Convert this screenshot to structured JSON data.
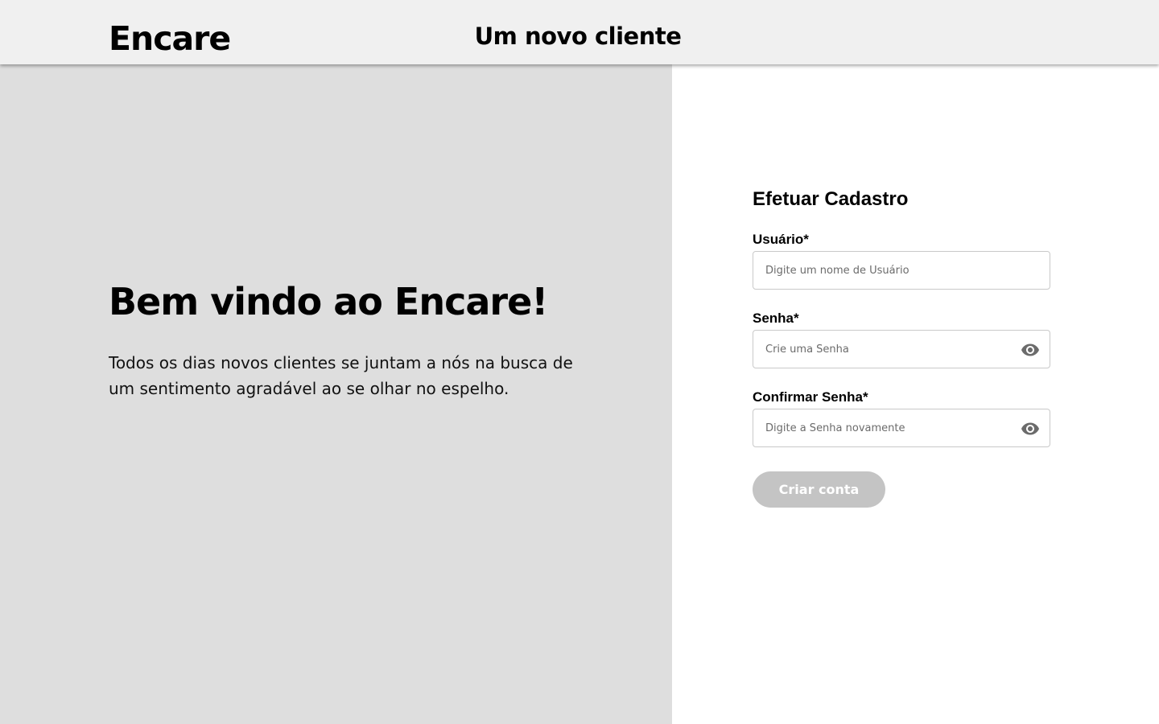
{
  "header": {
    "logo": "Encare",
    "title": "Um novo cliente"
  },
  "welcome": {
    "title": "Bem vindo ao Encare!",
    "text": "Todos os dias novos clientes se juntam a nós na busca de um sentimento agradável ao se olhar no espelho."
  },
  "form": {
    "title": "Efetuar Cadastro",
    "fields": [
      {
        "label": "Usuário*",
        "placeholder": "Digite um nome de Usuário",
        "value": ""
      },
      {
        "label": "Senha*",
        "placeholder": "Crie uma Senha",
        "value": "",
        "icon": "eye-icon"
      },
      {
        "label": "Confirmar Senha*",
        "placeholder": "Digite a Senha novamente",
        "value": "",
        "icon": "eye-icon"
      }
    ],
    "submit_label": "Criar conta"
  },
  "colors": {
    "header_bg": "#f0f0f0",
    "left_panel_bg": "#dedede",
    "button_bg": "#c4c4c4",
    "icon_color": "#6b6b6b"
  }
}
